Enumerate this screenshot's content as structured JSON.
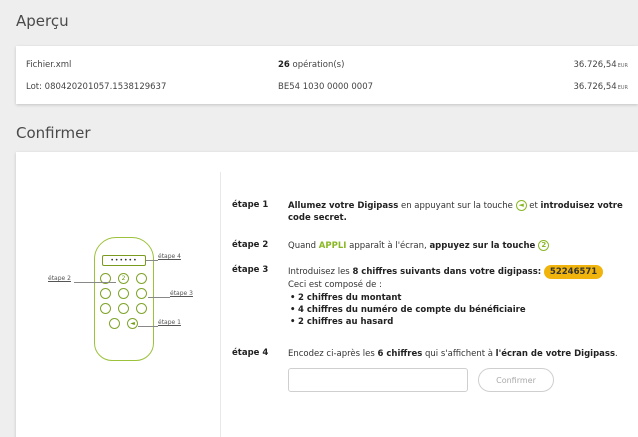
{
  "apercu": {
    "title": "Aperçu",
    "rows": [
      {
        "name": "Fichier.xml",
        "middle_bold": "26",
        "middle_rest": " opération(s)",
        "amount": "36.726,54",
        "currency": "EUR"
      },
      {
        "name": "Lot: 080420201057.1538129637",
        "middle_bold": "",
        "middle_rest": "BE54 1030 0000 0007",
        "amount": "36.726,54",
        "currency": "EUR"
      }
    ]
  },
  "confirmer": {
    "title": "Confirmer",
    "device": {
      "screen": "••••••",
      "key_2": "2",
      "key_arrow": "◄",
      "labels": {
        "etape1": "étape 1",
        "etape2": "étape 2",
        "etape3": "étape 3",
        "etape4": "étape 4"
      }
    },
    "steps": [
      {
        "label": "étape 1",
        "t1": "Allumez votre Digipass",
        "t2": " en appuyant sur la touche ",
        "icon": "◄",
        "t3": " et ",
        "t4": "introduisez votre code secret."
      },
      {
        "label": "étape 2",
        "t1": "Quand ",
        "green": "APPLI",
        "t2": " apparaît à l'écran, ",
        "t3": "appuyez sur la touche ",
        "icon": "2"
      },
      {
        "label": "étape 3",
        "t1": "Introduisez les ",
        "t2": "8 chiffres suivants dans votre digipass:",
        "code": "52246571",
        "intro": "Ceci est composé de :",
        "bullets": [
          "2 chiffres du montant",
          "4 chiffres du numéro de compte du bénéficiaire",
          "2 chiffres au hasard"
        ]
      },
      {
        "label": "étape 4",
        "t1": "Encodez ci-après les ",
        "t2": "6 chiffres",
        "t3": " qui s'affichent à ",
        "t4": "l'écran de votre Digipass",
        "t5": "."
      }
    ],
    "input_value": "",
    "confirm_label": "Confirmer"
  },
  "colors": {
    "accent_green": "#8ab825",
    "badge_yellow": "#f0b40d",
    "background": "#eeeeee"
  }
}
